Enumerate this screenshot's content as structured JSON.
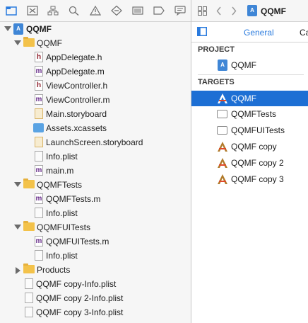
{
  "navigator": {
    "root": "QQMF",
    "group_qqmf": "QQMF",
    "files_qqmf": [
      "AppDelegate.h",
      "AppDelegate.m",
      "ViewController.h",
      "ViewController.m",
      "Main.storyboard",
      "Assets.xcassets",
      "LaunchScreen.storyboard",
      "Info.plist",
      "main.m"
    ],
    "group_tests": "QQMFTests",
    "files_tests": [
      "QQMFTests.m",
      "Info.plist"
    ],
    "group_uitests": "QQMFUITests",
    "files_uitests": [
      "QQMFUITests.m",
      "Info.plist"
    ],
    "group_products": "Products",
    "plists": [
      "QQMF copy-Info.plist",
      "QQMF copy 2-Info.plist",
      "QQMF copy 3-Info.plist"
    ]
  },
  "editor": {
    "breadcrumb": "QQMF",
    "tab_general": "General",
    "tab_next": "Ca"
  },
  "project_section": {
    "heading": "PROJECT",
    "item": "QQMF"
  },
  "targets_section": {
    "heading": "TARGETS",
    "items": [
      "QQMF",
      "QQMFTests",
      "QQMFUITests",
      "QQMF copy",
      "QQMF copy 2",
      "QQMF copy 3"
    ]
  },
  "colors": {
    "selection": "#1d6fd4",
    "accent": "#2a7bde",
    "folder": "#f3c24a"
  }
}
